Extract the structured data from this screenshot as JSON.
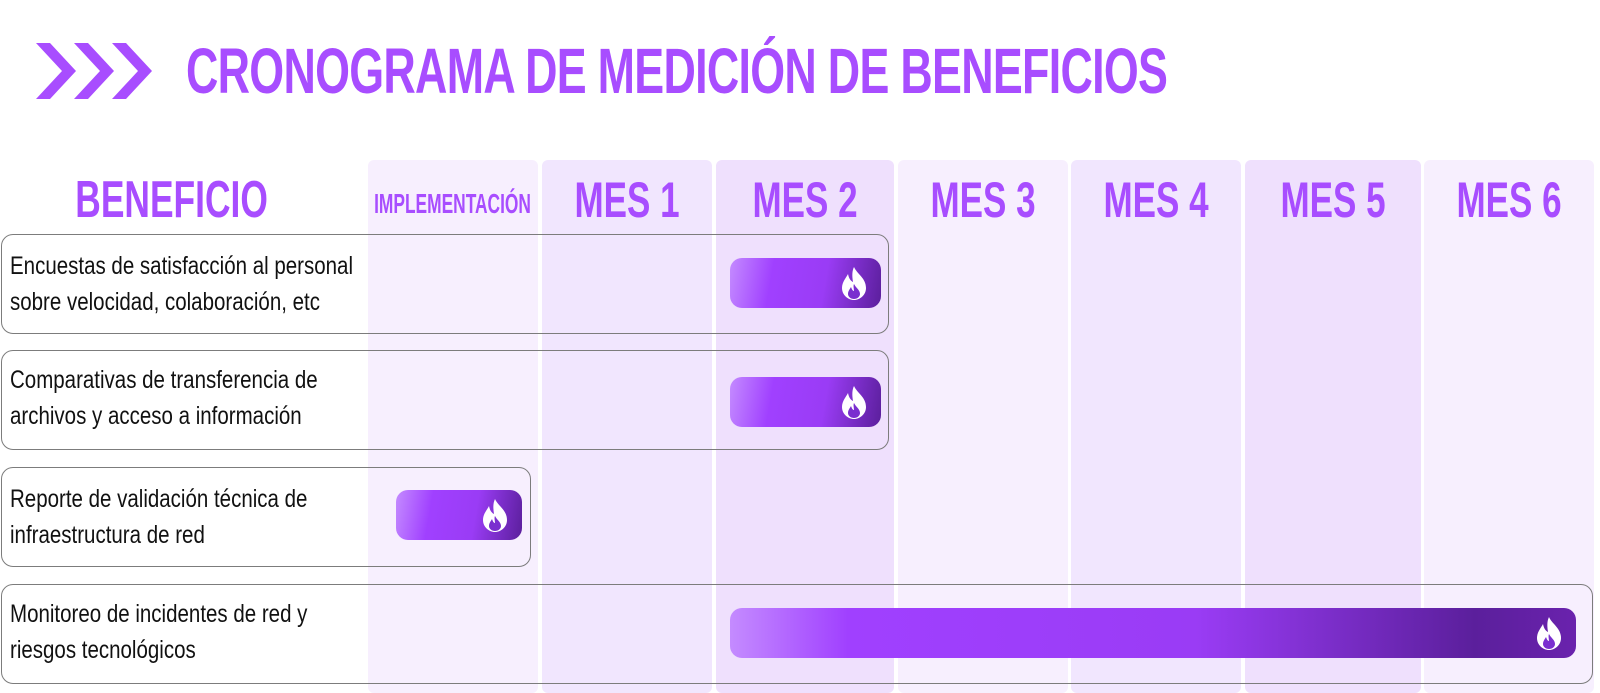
{
  "title": "CRONOGRAMA DE MEDICIÓN DE BENEFICIOS",
  "title_icon": "triple-chevron-icon",
  "colors": {
    "accent": "#a84dff",
    "column_light": "#f7effe",
    "column_dark": "#efe0fd",
    "bar_start": "#c48bff",
    "bar_mid": "#a040ff",
    "bar_end": "#5b1f9c"
  },
  "columns": {
    "benefit": "BENEFICIO",
    "periods": [
      "IMPLEMENTACIÓN",
      "MES 1",
      "MES 2",
      "MES 3",
      "MES 4",
      "MES 5",
      "MES 6"
    ]
  },
  "rows": [
    {
      "label_line1": "Encuestas de satisfacción al personal",
      "label_line2": "sobre velocidad, colaboración, etc",
      "start_period": "MES 2",
      "end_period": "MES 2",
      "icon": "flame-icon"
    },
    {
      "label_line1": "Comparativas de transferencia de",
      "label_line2": "archivos y acceso a información",
      "start_period": "MES 2",
      "end_period": "MES 2",
      "icon": "flame-icon"
    },
    {
      "label_line1": "Reporte de validación técnica de",
      "label_line2": "infraestructura de red",
      "start_period": "IMPLEMENTACIÓN",
      "end_period": "IMPLEMENTACIÓN",
      "icon": "flame-icon"
    },
    {
      "label_line1": "Monitoreo de incidentes de red y",
      "label_line2": "riesgos tecnológicos",
      "start_period": "MES 2",
      "end_period": "MES 6",
      "icon": "flame-icon"
    }
  ]
}
